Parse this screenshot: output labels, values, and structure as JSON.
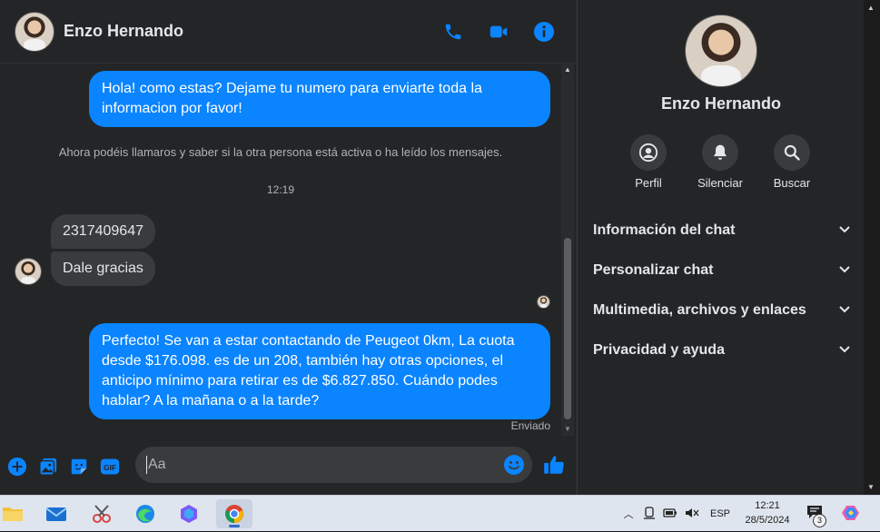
{
  "contact": {
    "name": "Enzo Hernando"
  },
  "header": {
    "call_icon": "phone-icon",
    "video_icon": "video-camera-icon",
    "info_icon": "info-icon",
    "accent": "#0a84ff"
  },
  "messages": {
    "outgoing_1": "Hola! como estas? Dejame tu numero para enviarte toda la informacion por favor!",
    "system_note": "Ahora podéis llamaros y saber si la otra persona está activa o ha leído los mensajes.",
    "time_separator": "12:19",
    "incoming_1": "2317409647",
    "incoming_2": "Dale gracias",
    "outgoing_2": "Perfecto!  Se van a estar contactando de Peugeot 0km, La cuota desde $176.098. es de un 208, también hay otras opciones, el anticipo mínimo para retirar es de $6.827.850. Cuándo podes hablar? A la mañana o a la tarde?",
    "status": "Enviado"
  },
  "composer": {
    "placeholder": "Aa",
    "icons": [
      "plus-circle-icon",
      "photo-icon",
      "sticker-icon",
      "gif-icon",
      "emoji-icon",
      "thumbs-up-icon"
    ],
    "gif_label": "GIF"
  },
  "panel": {
    "name": "Enzo Hernando",
    "actions": [
      {
        "label": "Perfil",
        "icon": "profile-icon"
      },
      {
        "label": "Silenciar",
        "icon": "bell-icon"
      },
      {
        "label": "Buscar",
        "icon": "search-icon"
      }
    ],
    "sections": [
      "Información del chat",
      "Personalizar chat",
      "Multimedia, archivos y enlaces",
      "Privacidad y ayuda"
    ]
  },
  "taskbar": {
    "apps": [
      "file-explorer-icon",
      "mail-icon",
      "snipping-tool-icon",
      "edge-icon",
      "copilot-app-icon",
      "chrome-icon"
    ],
    "language": "ESP",
    "time": "12:21",
    "date": "28/5/2024",
    "notification_count": "3"
  }
}
